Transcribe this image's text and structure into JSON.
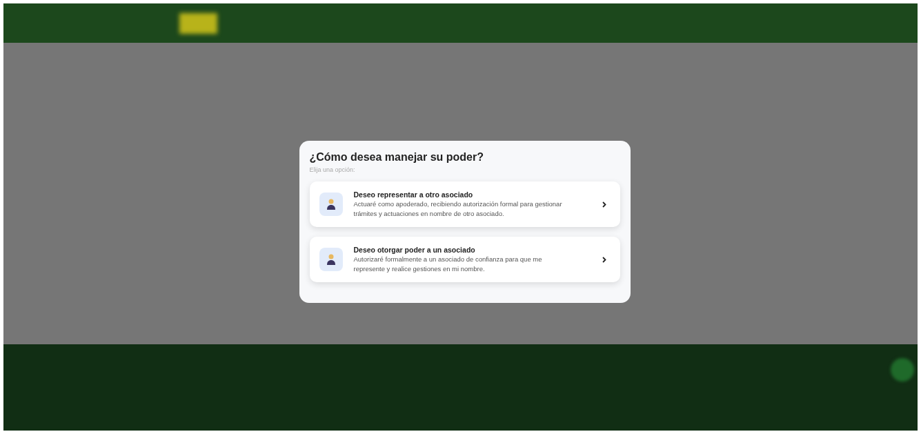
{
  "modal": {
    "title": "¿Cómo desea manejar su poder?",
    "subtitle": "Elija una opción:",
    "options": [
      {
        "title": "Deseo representar a otro asociado",
        "description": "Actuaré como apoderado, recibiendo autorización formal para gestionar trámites y actuaciones en nombre de otro asociado."
      },
      {
        "title": "Deseo otorgar poder a un asociado",
        "description": "Autorizaré formalmente a un asociado de confianza para que me represente y realice gestiones en mi nombre."
      }
    ]
  }
}
